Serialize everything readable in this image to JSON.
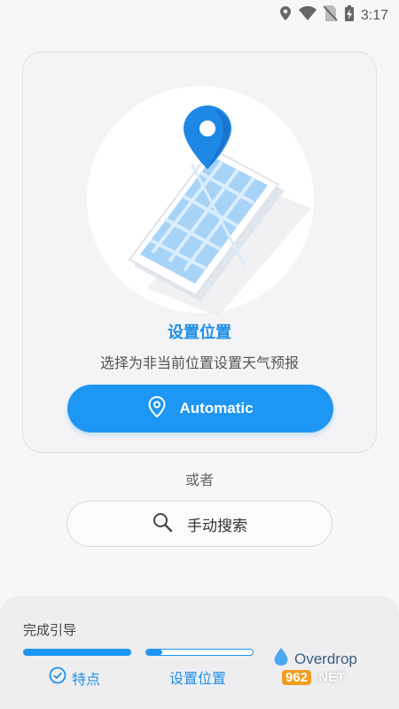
{
  "status_bar": {
    "time": "3:17",
    "icons": [
      "location-icon",
      "wifi-icon",
      "no-sim-icon",
      "battery-charging-icon"
    ]
  },
  "card": {
    "title": "设置位置",
    "subtitle": "选择为非当前位置设置天气预报",
    "automatic_button": "Automatic"
  },
  "or_text": "或者",
  "manual_search_label": "手动搜索",
  "guide": {
    "title": "完成引导",
    "steps": [
      {
        "label": "特点",
        "progress": 1.0
      },
      {
        "label": "设置位置",
        "progress": 0.15
      }
    ]
  },
  "brand": {
    "name": "Overdrop"
  },
  "watermark": {
    "number": "962",
    "net": ".NET",
    "site": "乐游网"
  },
  "colors": {
    "accent": "#1e96f3",
    "title": "#1f8ee8",
    "background": "#f7f7f8"
  }
}
